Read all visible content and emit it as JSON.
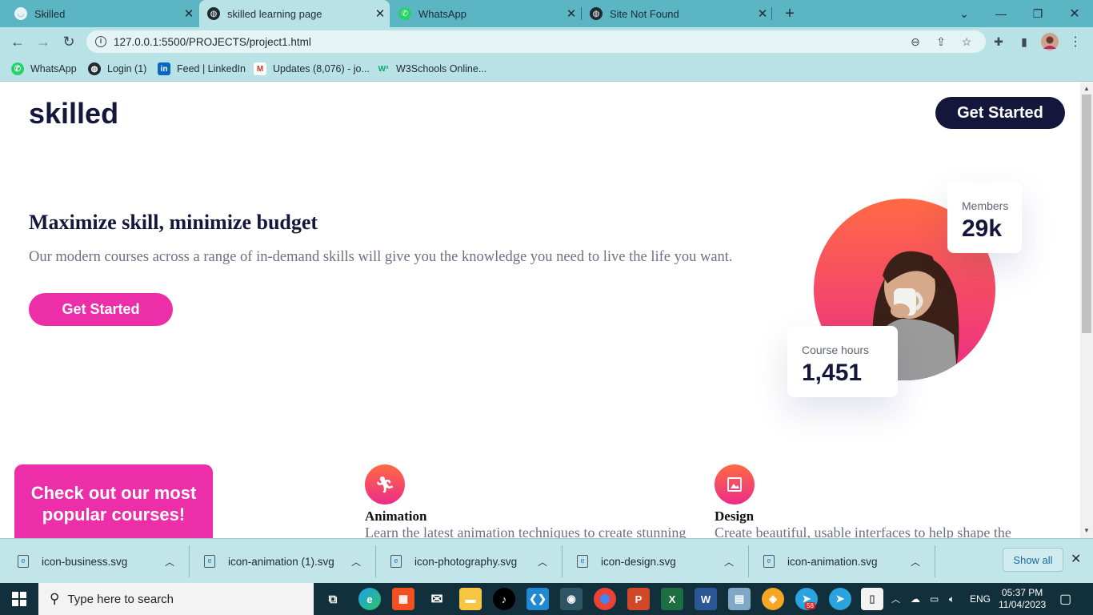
{
  "browser": {
    "tabs": [
      {
        "title": "Skilled",
        "icon": "skilled-favicon"
      },
      {
        "title": "skilled learning page",
        "icon": "globe-icon",
        "active": true
      },
      {
        "title": "WhatsApp",
        "icon": "whatsapp-icon"
      },
      {
        "title": "Site Not Found",
        "icon": "globe-icon"
      }
    ],
    "url": "127.0.0.1:5500/PROJECTS/project1.html",
    "bookmarks": [
      {
        "label": "WhatsApp",
        "icon": "whatsapp-icon"
      },
      {
        "label": "Login (1)",
        "icon": "globe-icon"
      },
      {
        "label": "Feed | LinkedIn",
        "icon": "linkedin-icon"
      },
      {
        "label": "Updates (8,076) - jo...",
        "icon": "gmail-icon"
      },
      {
        "label": "W3Schools Online...",
        "icon": "w3schools-icon"
      }
    ]
  },
  "site": {
    "logo": "skilled",
    "header_button": "Get Started",
    "hero": {
      "heading": "Maximize skill, minimize budget",
      "text": "Our modern courses across a range of in-demand skills will give you the knowledge you need to live the life you want.",
      "button": "Get Started"
    },
    "stats": {
      "members_label": "Members",
      "members_value": "29k",
      "hours_label": "Course hours",
      "hours_value": "1,451"
    },
    "promo": "Check out our most popular courses!",
    "courses": [
      {
        "title": "Animation",
        "desc": "Learn the latest animation techniques to create stunning",
        "icon": "running-person-icon"
      },
      {
        "title": "Design",
        "desc": "Create beautiful, usable interfaces to help shape the",
        "icon": "image-icon"
      }
    ]
  },
  "downloads": {
    "items": [
      "icon-business.svg",
      "icon-animation (1).svg",
      "icon-photography.svg",
      "icon-design.svg",
      "icon-animation.svg"
    ],
    "show_all": "Show all"
  },
  "taskbar": {
    "search_placeholder": "Type here to search",
    "lang": "ENG",
    "time": "05:37 PM",
    "date": "11/04/2023",
    "telegram_badge": "58"
  },
  "colors": {
    "navy": "#14163c",
    "pink": "#ec2fa8",
    "gradient_start": "#ff6a43",
    "gradient_end": "#ec2c89",
    "chrome_teal": "#5bb5c2"
  }
}
